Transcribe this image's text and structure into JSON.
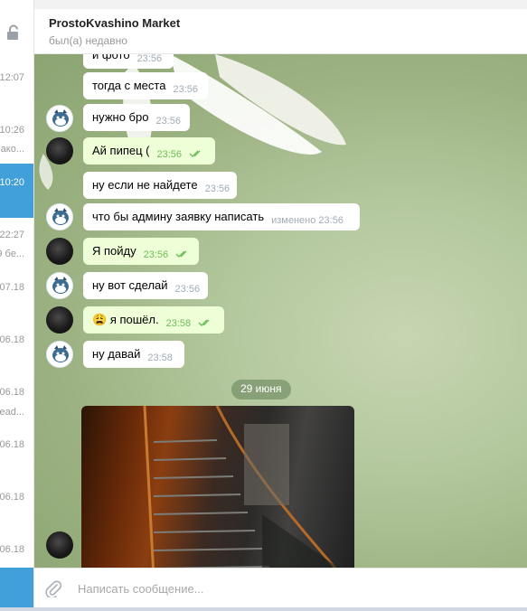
{
  "header": {
    "title": "ProstoKvashino Market",
    "status": "был(а) недавно"
  },
  "left_list": {
    "items": [
      {
        "text": "12:07"
      },
      {
        "text": "10:26"
      },
      {
        "text": "ако..."
      },
      {
        "text": "10:20"
      },
      {
        "text": "22:27"
      },
      {
        "text": "9 бе..."
      },
      {
        "text": "07.18"
      },
      {
        "text": "06.18"
      },
      {
        "text": "06.18"
      },
      {
        "text": "ead..."
      },
      {
        "text": "06.18"
      },
      {
        "text": "06.18"
      },
      {
        "text": "06.18"
      }
    ]
  },
  "messages": [
    {
      "text": "и фото",
      "time": "23:56"
    },
    {
      "text": "тогда с места",
      "time": "23:56"
    },
    {
      "text": "нужно бро",
      "time": "23:56"
    },
    {
      "text": "Ай пипец (",
      "time": "23:56"
    },
    {
      "text": "ну если не найдете",
      "time": "23:56"
    },
    {
      "text": "что бы админу заявку написать",
      "time": "изменено 23:56"
    },
    {
      "text": "Я пойду",
      "time": "23:56"
    },
    {
      "text": "ну вот сделай",
      "time": "23:56"
    },
    {
      "text": "я пошёл.",
      "emoji": "😩",
      "time": "23:58"
    },
    {
      "text": "ну давай",
      "time": "23:58"
    }
  ],
  "date_separator": "29 июня",
  "composer": {
    "placeholder": "Написать сообщение..."
  },
  "icons": {
    "lock": "lock-icon",
    "attach": "paperclip-icon",
    "read": "double-check-icon"
  },
  "colors": {
    "accent": "#419fd9",
    "outgoing_bubble": "#eefed6",
    "incoming_bubble": "#ffffff",
    "check": "#6cbf5a"
  }
}
